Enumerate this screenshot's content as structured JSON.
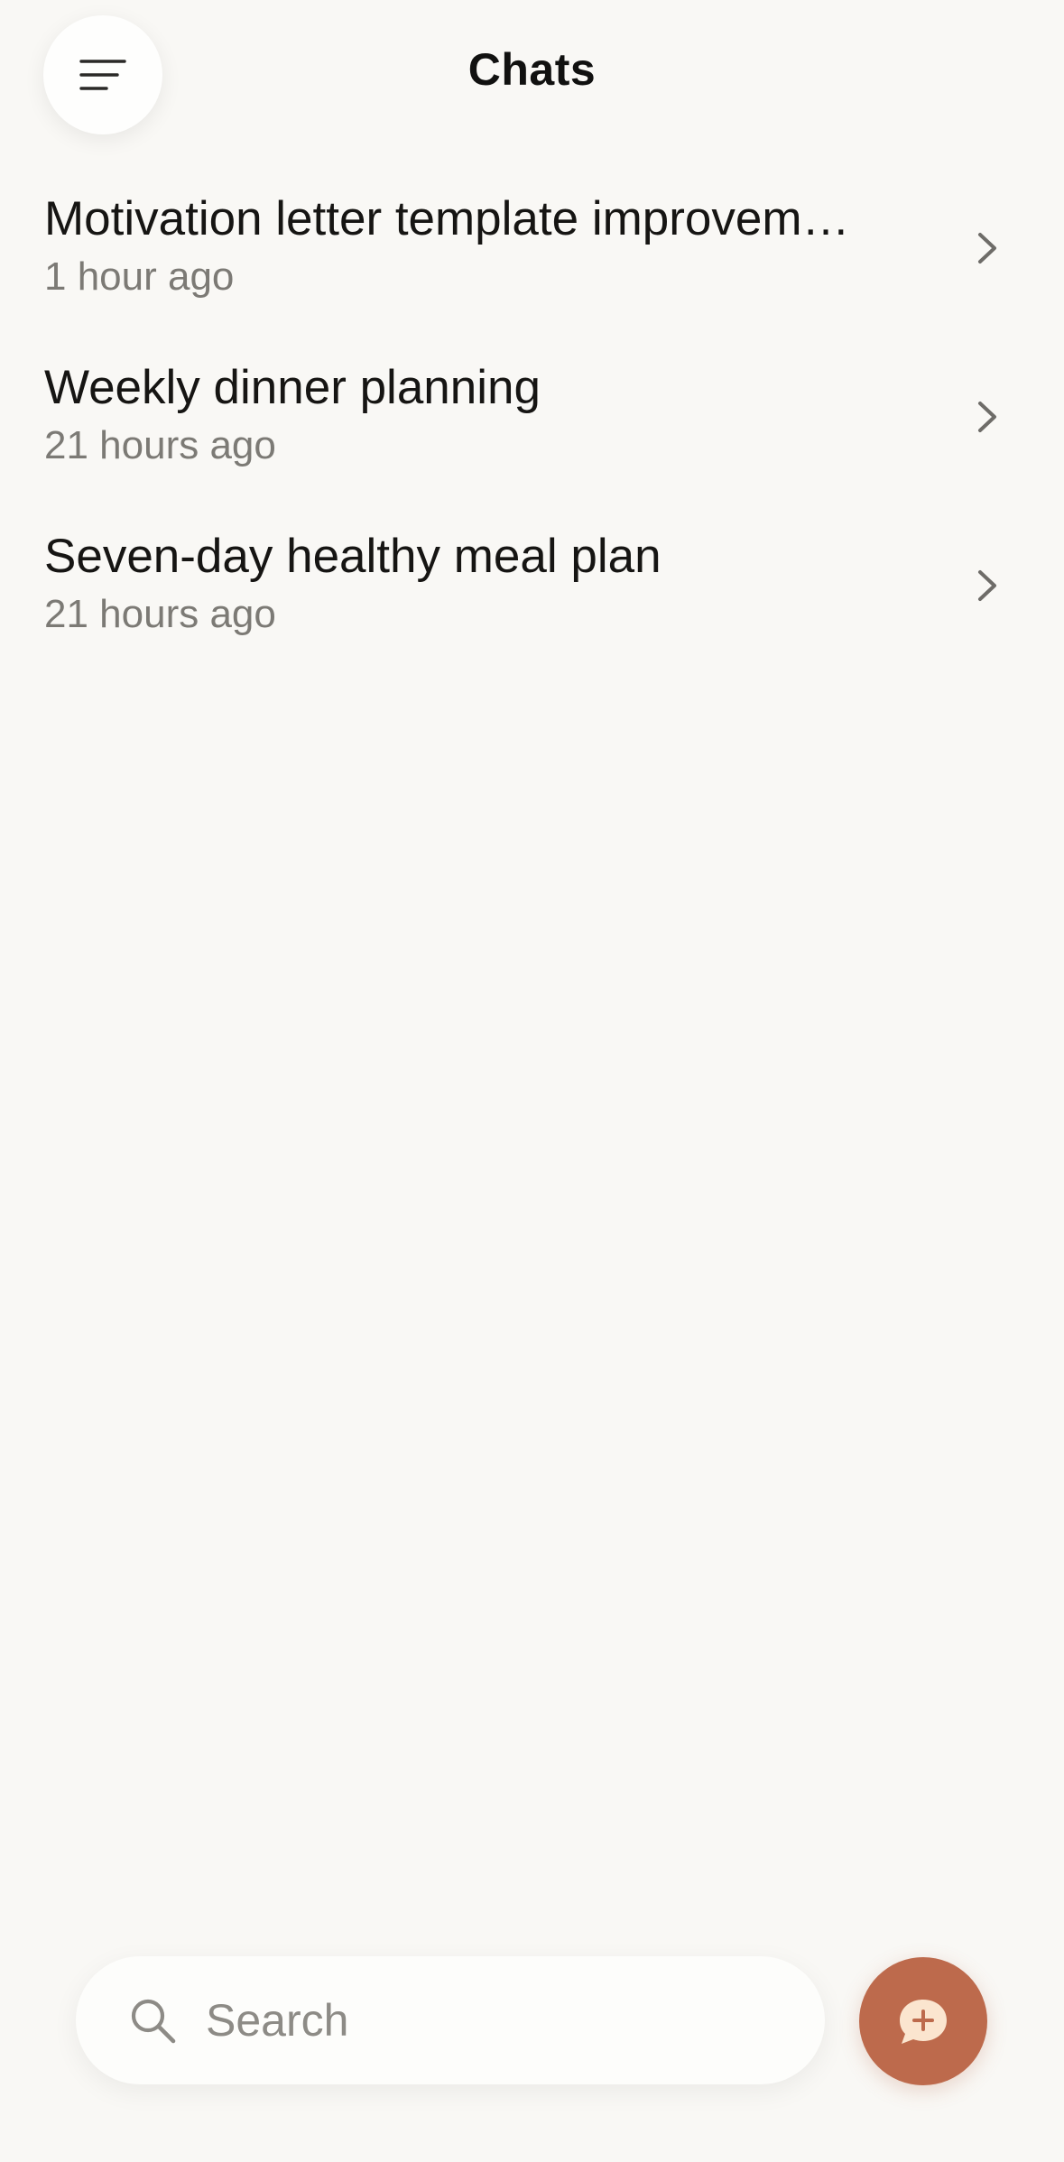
{
  "header": {
    "title": "Chats",
    "menu_icon": "menu-lines-icon"
  },
  "chats": [
    {
      "title": "Motivation letter template improvem…",
      "time": "1 hour ago"
    },
    {
      "title": "Weekly dinner planning",
      "time": "21 hours ago"
    },
    {
      "title": "Seven-day healthy meal plan",
      "time": "21 hours ago"
    }
  ],
  "search": {
    "placeholder": "Search",
    "value": "",
    "icon": "search-icon"
  },
  "new_chat": {
    "icon": "new-chat-icon"
  },
  "colors": {
    "background": "#f9f8f5",
    "accent": "#bd6a4c",
    "accent_light": "#fbe5cf",
    "secondary_text": "#7c7a75"
  }
}
